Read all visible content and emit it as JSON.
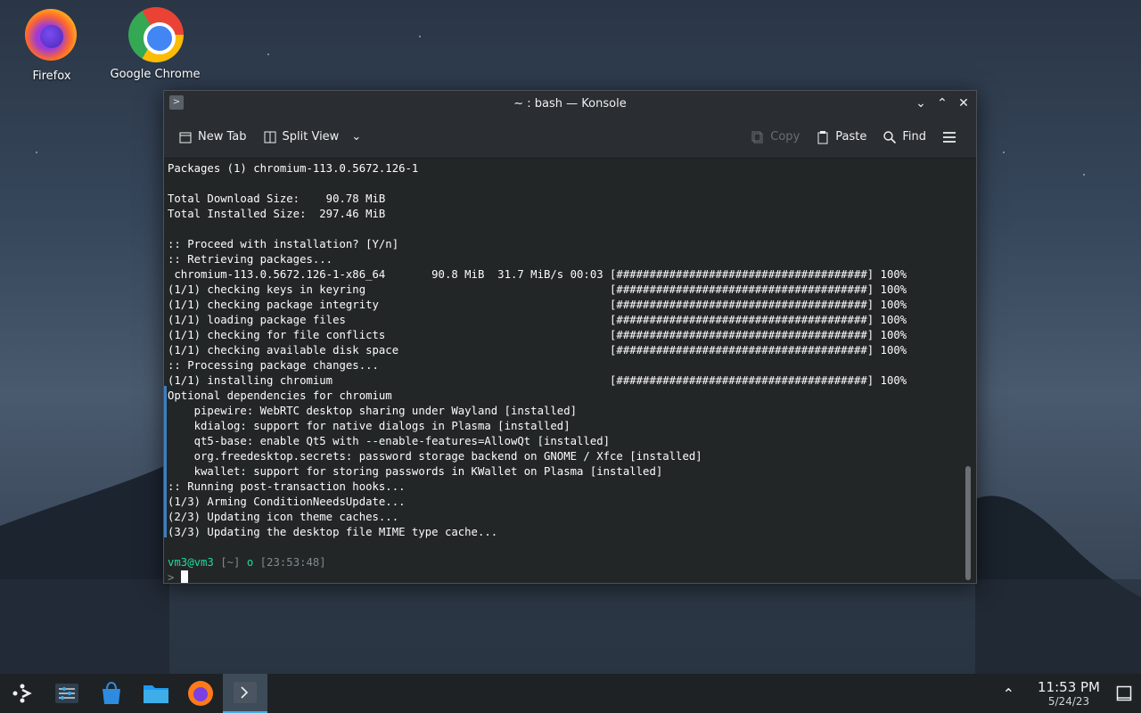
{
  "desktop": {
    "icons": [
      {
        "label": "Firefox",
        "icon": "firefox-icon"
      },
      {
        "label": "Google Chrome",
        "icon": "chrome-icon"
      }
    ]
  },
  "window": {
    "title": "~ : bash — Konsole",
    "toolbar": {
      "new_tab": "New Tab",
      "split_view": "Split View",
      "copy": "Copy",
      "paste": "Paste",
      "find": "Find"
    }
  },
  "terminal": {
    "lines": [
      "Packages (1) chromium-113.0.5672.126-1",
      "",
      "Total Download Size:    90.78 MiB",
      "Total Installed Size:  297.46 MiB",
      "",
      ":: Proceed with installation? [Y/n]",
      ":: Retrieving packages...",
      " chromium-113.0.5672.126-1-x86_64       90.8 MiB  31.7 MiB/s 00:03 [######################################] 100%",
      "(1/1) checking keys in keyring                                     [######################################] 100%",
      "(1/1) checking package integrity                                   [######################################] 100%",
      "(1/1) loading package files                                        [######################################] 100%",
      "(1/1) checking for file conflicts                                  [######################################] 100%",
      "(1/1) checking available disk space                                [######################################] 100%",
      ":: Processing package changes...",
      "(1/1) installing chromium                                          [######################################] 100%",
      "Optional dependencies for chromium",
      "    pipewire: WebRTC desktop sharing under Wayland [installed]",
      "    kdialog: support for native dialogs in Plasma [installed]",
      "    qt5-base: enable Qt5 with --enable-features=AllowQt [installed]",
      "    org.freedesktop.secrets: password storage backend on GNOME / Xfce [installed]",
      "    kwallet: support for storing passwords in KWallet on Plasma [installed]",
      ":: Running post-transaction hooks...",
      "(1/3) Arming ConditionNeedsUpdate...",
      "(2/3) Updating icon theme caches...",
      "(3/3) Updating the desktop file MIME type cache...",
      ""
    ],
    "prompt": {
      "user_host": "vm3@vm3",
      "dir": "[~]",
      "sep": "o",
      "time": "[23:53:48]",
      "symbol": ">"
    }
  },
  "taskbar": {
    "clock_time": "11:53 PM",
    "clock_date": "5/24/23"
  },
  "colors": {
    "accent": "#3daee9",
    "prompt_green": "#1cdc9a",
    "terminal_bg": "#232627"
  }
}
